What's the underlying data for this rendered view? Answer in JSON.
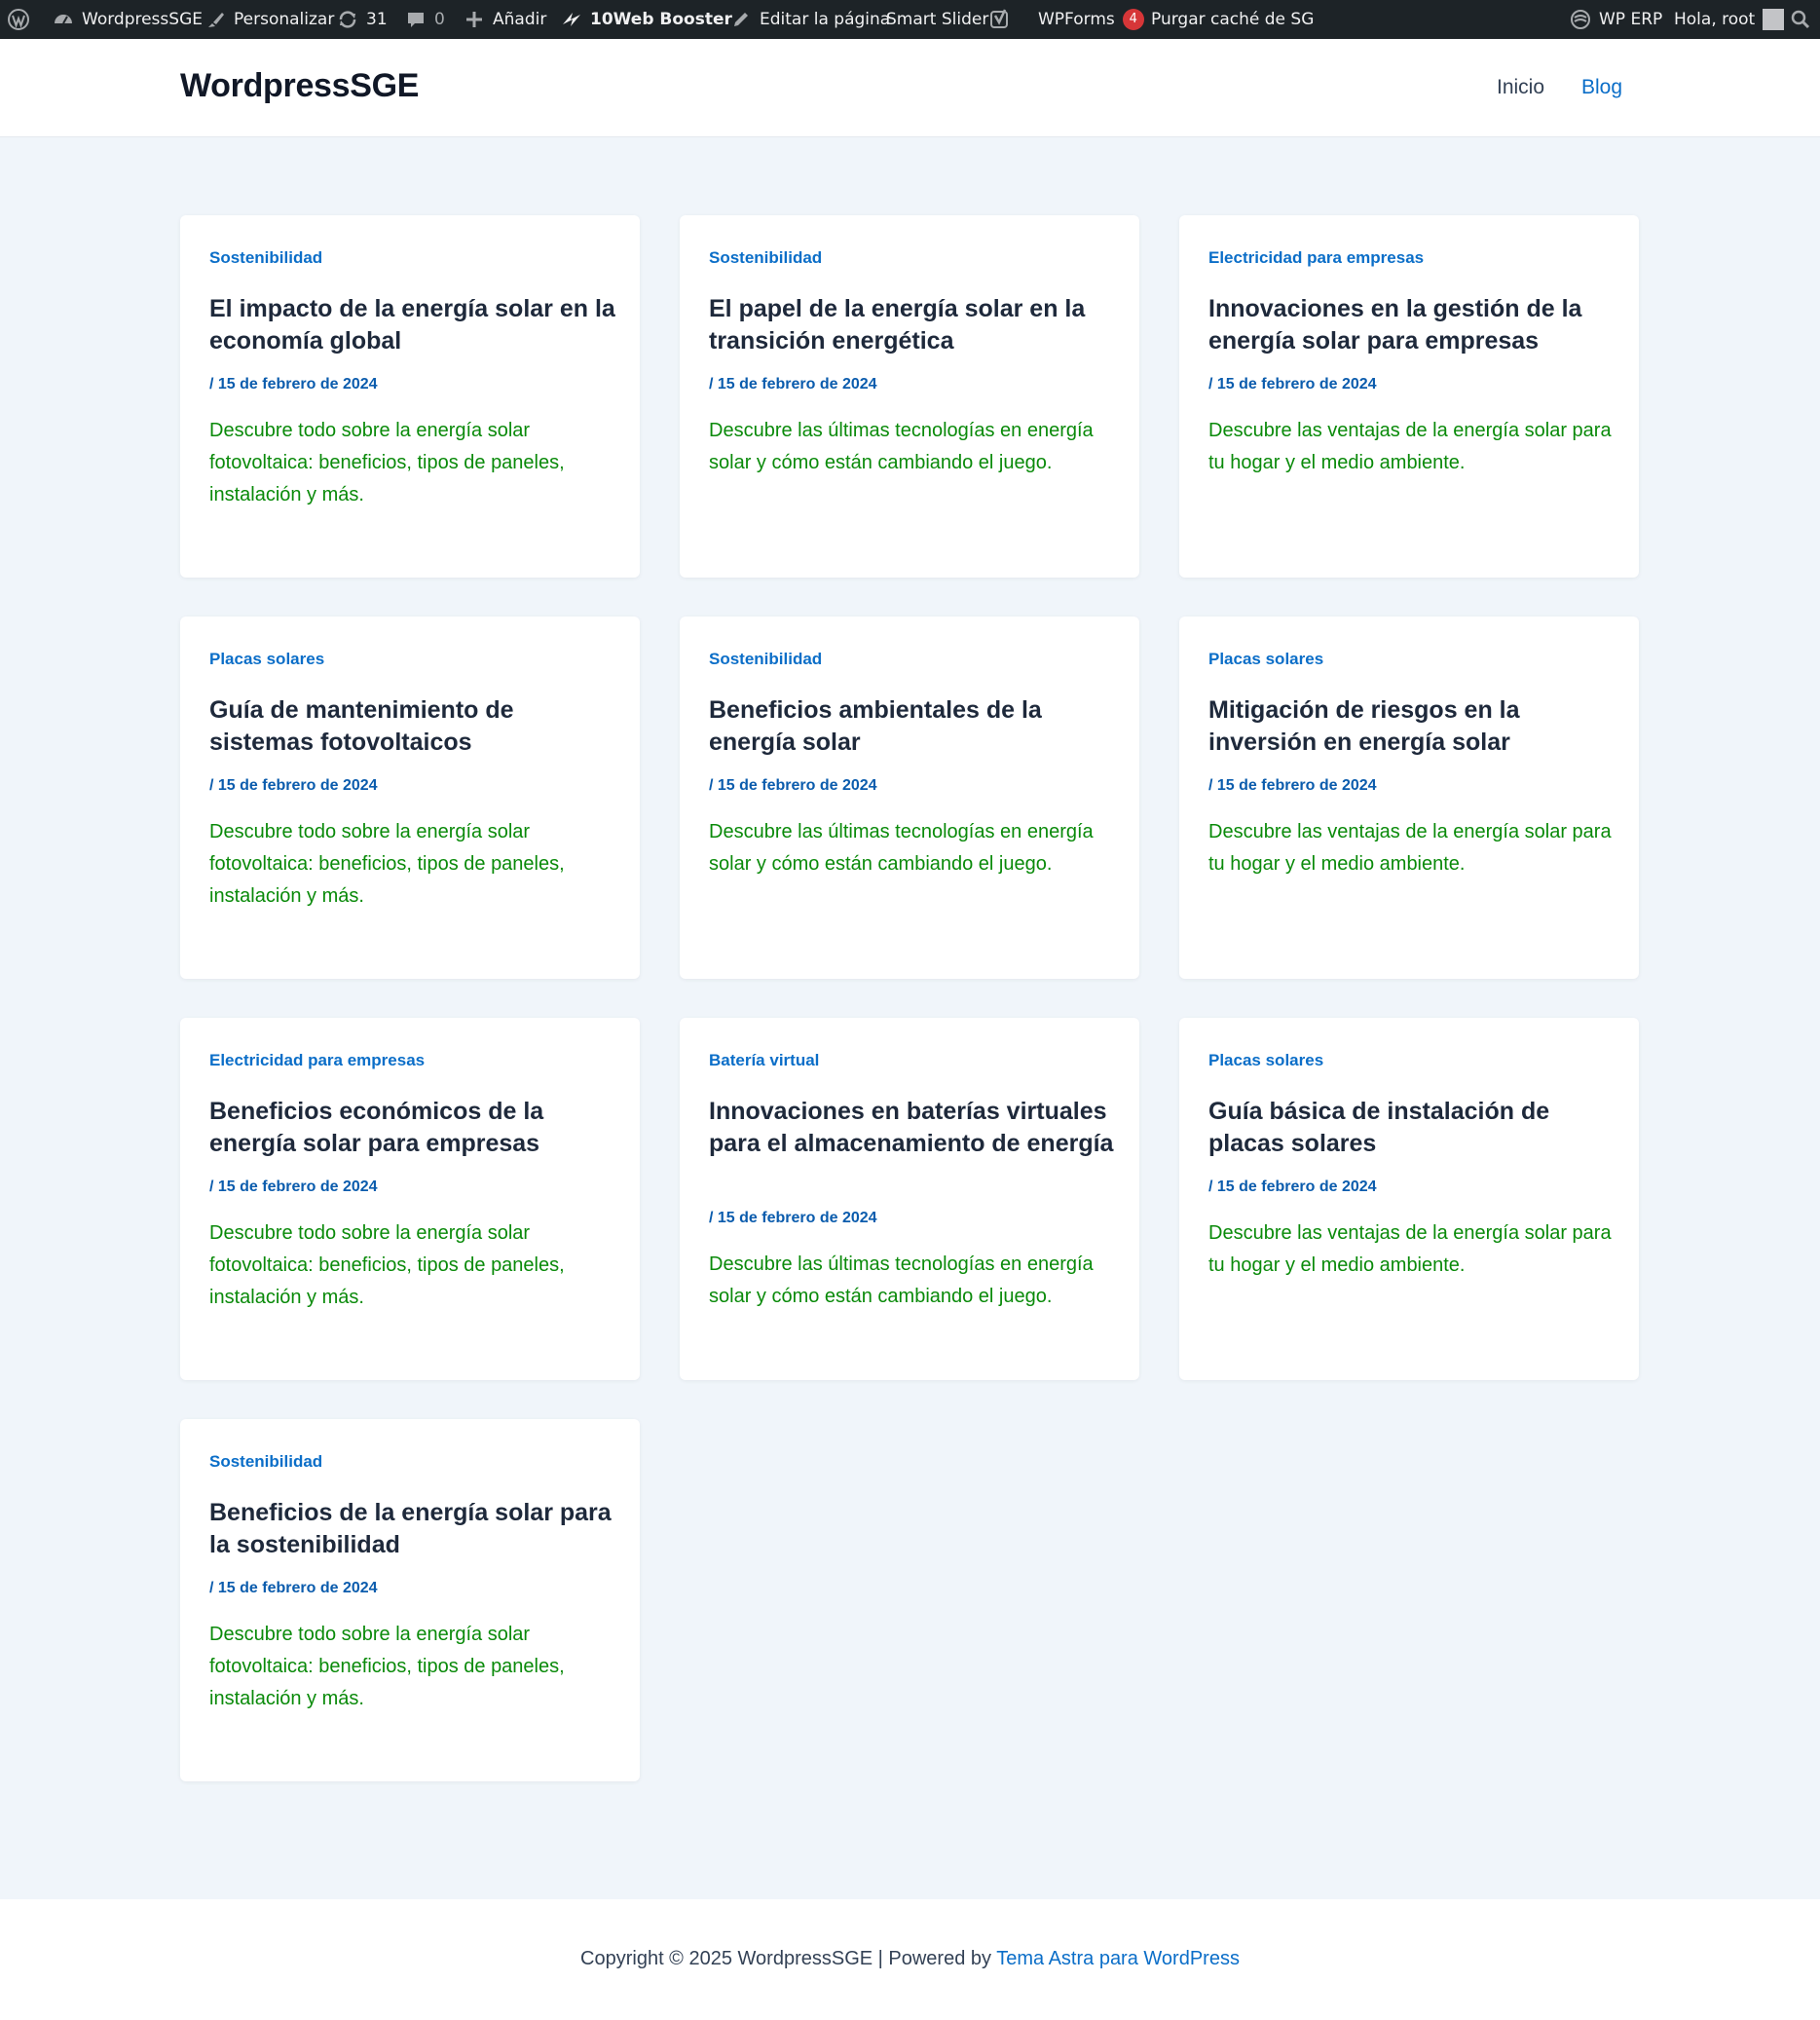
{
  "adminbar": {
    "wp_logo_icon": "wordpress-icon",
    "site_name": "WordpressSGE",
    "customize": "Personalizar",
    "updates_count": "31",
    "comments_count": "0",
    "add_new": "Añadir",
    "booster": "10Web Booster",
    "edit_page": "Editar la página",
    "smart_slider": "Smart Slider",
    "wpforms": "WPForms",
    "wpforms_badge": "4",
    "purge_cache": "Purgar caché de SG",
    "wp_erp": "WP ERP",
    "greeting": "Hola, root"
  },
  "header": {
    "site_title": "WordpressSGE",
    "nav": [
      "Inicio",
      "Blog"
    ]
  },
  "posts": [
    {
      "category": "Sostenibilidad",
      "title": "El impacto de la energía solar en la economía global",
      "date": "/ 15 de febrero de 2024",
      "excerpt": "Descubre todo sobre la energía solar fotovoltaica: beneficios, tipos de paneles, instalación y más."
    },
    {
      "category": "Sostenibilidad",
      "title": "El papel de la energía solar en la transición energética",
      "date": "/ 15 de febrero de 2024",
      "excerpt": "Descubre las últimas tecnologías en energía solar y cómo están cambiando el juego."
    },
    {
      "category": "Electricidad para empresas",
      "title": "Innovaciones en la gestión de la energía solar para empresas",
      "date": "/ 15 de febrero de 2024",
      "excerpt": "Descubre las ventajas de la energía solar para tu hogar y el medio ambiente."
    },
    {
      "category": "Placas solares",
      "title": "Guía de mantenimiento de sistemas fotovoltaicos",
      "date": "/ 15 de febrero de 2024",
      "excerpt": "Descubre todo sobre la energía solar fotovoltaica: beneficios, tipos de paneles, instalación y más."
    },
    {
      "category": "Sostenibilidad",
      "title": "Beneficios ambientales de la energía solar",
      "date": "/ 15 de febrero de 2024",
      "excerpt": "Descubre las últimas tecnologías en energía solar y cómo están cambiando el juego."
    },
    {
      "category": "Placas solares",
      "title": "Mitigación de riesgos en la inversión en energía solar",
      "date": "/ 15 de febrero de 2024",
      "excerpt": "Descubre las ventajas de la energía solar para tu hogar y el medio ambiente."
    },
    {
      "category": "Electricidad para empresas",
      "title": "Beneficios económicos de la energía solar para empresas",
      "date": "/ 15 de febrero de 2024",
      "excerpt": "Descubre todo sobre la energía solar fotovoltaica: beneficios, tipos de paneles, instalación y más."
    },
    {
      "category": "Batería virtual",
      "title": "Innovaciones en baterías virtuales para el almacenamiento de energía",
      "date": "/ 15 de febrero de 2024",
      "excerpt": "Descubre las últimas tecnologías en energía solar y cómo están cambiando el juego."
    },
    {
      "category": "Placas solares",
      "title": "Guía básica de instalación de placas solares",
      "date": "/ 15 de febrero de 2024",
      "excerpt": "Descubre las ventajas de la energía solar para tu hogar y el medio ambiente."
    },
    {
      "category": "Sostenibilidad",
      "title": "Beneficios de la energía solar para la sostenibilidad",
      "date": "/ 15 de febrero de 2024",
      "excerpt": "Descubre todo sobre la energía solar fotovoltaica: beneficios, tipos de paneles, instalación y más."
    }
  ],
  "footer": {
    "text": "Copyright © 2025 WordpressSGE | Powered by ",
    "link": "Tema Astra para WordPress"
  }
}
